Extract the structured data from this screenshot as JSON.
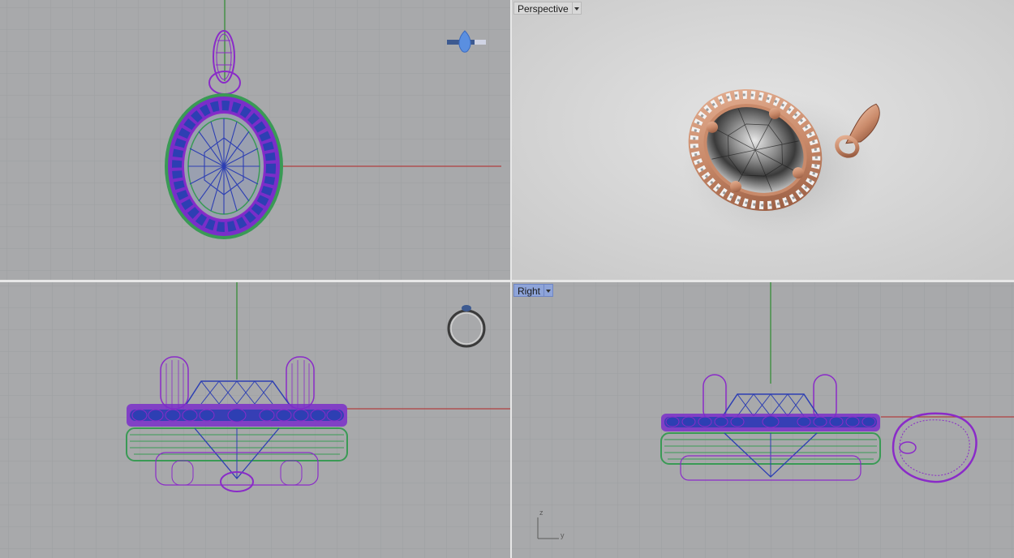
{
  "viewports": {
    "top": {
      "label": ""
    },
    "perspective": {
      "label": "Perspective",
      "active": false
    },
    "front": {
      "label": ""
    },
    "right": {
      "label": "Right",
      "active": true
    }
  },
  "axis_widget": {
    "z": "z",
    "y": "y"
  },
  "colors": {
    "grid_bg": "#a8a9ab",
    "grid_line": "#9d9ea0",
    "grid_major": "#8f9092",
    "axis_x": "#b04040",
    "axis_y": "#2e8b2e",
    "metal_wire": "#8a2bc8",
    "stone_wire": "#2d3fb3",
    "prong_wire": "#3a9a55",
    "rose_gold": "#c98a6a"
  },
  "icons": {
    "top_thumb": "pendant-thumbnail-icon",
    "front_thumb": "ring-thumbnail-icon"
  }
}
